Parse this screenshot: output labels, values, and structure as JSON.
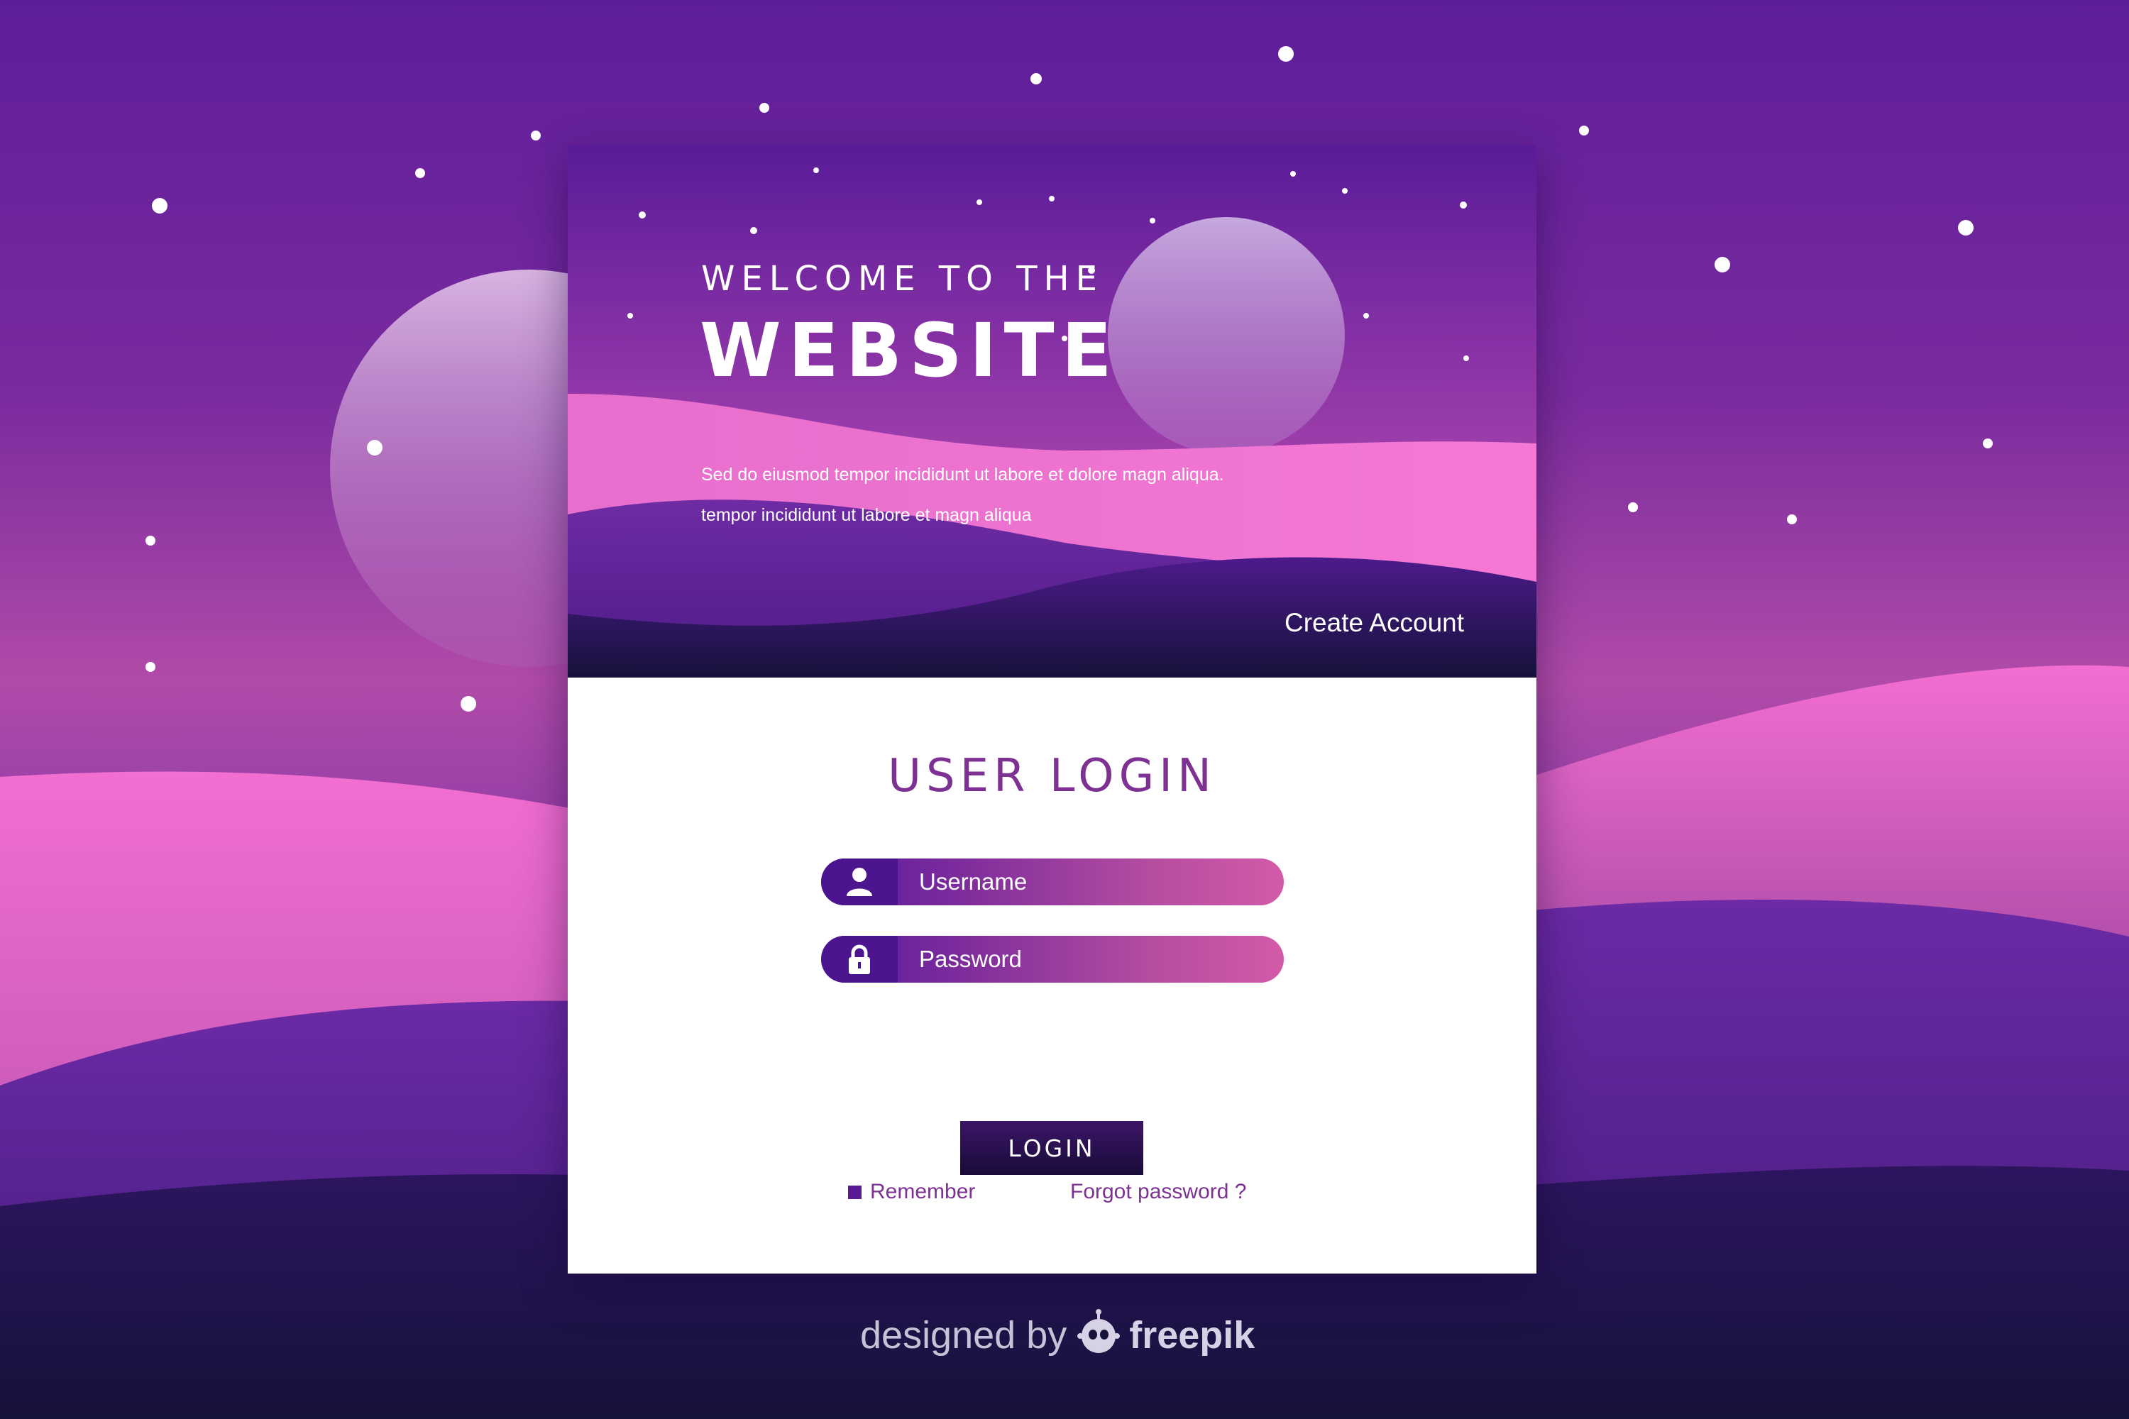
{
  "hero": {
    "welcome_line": "WELCOME TO THE",
    "title": "WEBSITE",
    "description_line_1": "Sed do eiusmod tempor incididunt ut labore et dolore magn aliqua.",
    "description_line_2": "tempor incididunt ut labore et  magn aliqua",
    "create_account": "Create Account"
  },
  "login": {
    "title": "USER LOGIN",
    "username_placeholder": "Username",
    "password_placeholder": "Password",
    "remember_label": "Remember",
    "forgot_label": "Forgot password ?",
    "button_label": "LOGIN"
  },
  "footer": {
    "credit_prefix": "designed by",
    "credit_brand": "freepik"
  },
  "icons": {
    "username": "user-icon",
    "password": "lock-icon",
    "credit": "freepik-logo-icon"
  },
  "colors": {
    "accent": "#7c3193",
    "field_gradient_start": "#561a9c",
    "field_gradient_end": "#d35aa9",
    "button_dark": "#180b38",
    "hill_pink": "#f070cc"
  }
}
